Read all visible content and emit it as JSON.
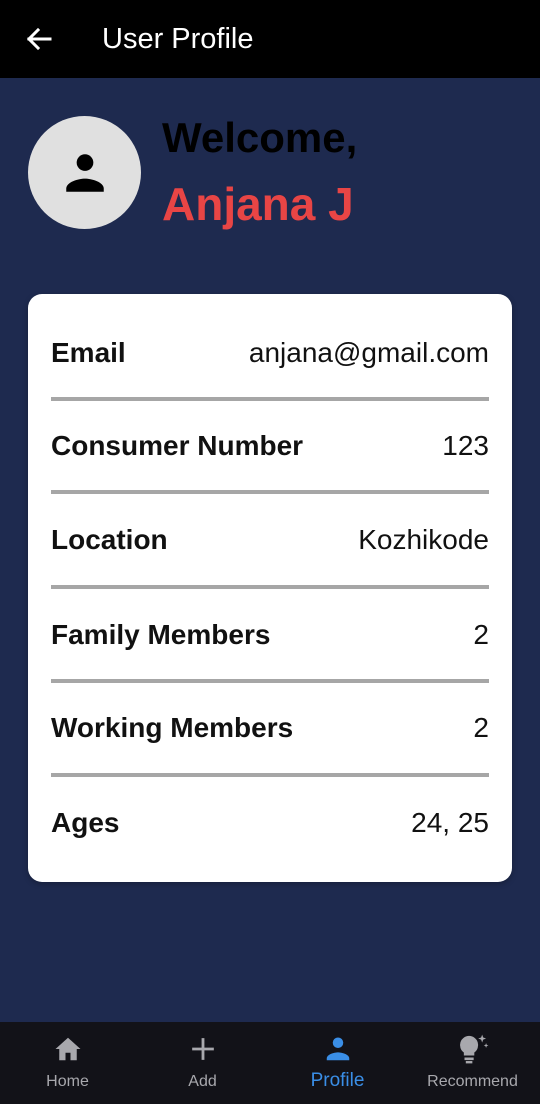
{
  "appbar": {
    "title": "User Profile",
    "back_icon": "arrow-back-icon"
  },
  "header": {
    "avatar_icon": "person-icon",
    "welcome": "Welcome,",
    "name": "Anjana J",
    "name_color": "#e84545"
  },
  "profile": {
    "rows": [
      {
        "label": "Email",
        "value": "anjana@gmail.com"
      },
      {
        "label": "Consumer Number",
        "value": "123"
      },
      {
        "label": "Location",
        "value": "Kozhikode"
      },
      {
        "label": "Family Members",
        "value": "2"
      },
      {
        "label": "Working Members",
        "value": "2"
      },
      {
        "label": "Ages",
        "value": "24, 25"
      }
    ]
  },
  "nav": {
    "items": [
      {
        "label": "Home",
        "icon": "home-icon"
      },
      {
        "label": "Add",
        "icon": "plus-icon"
      },
      {
        "label": "Profile",
        "icon": "person-icon",
        "active": true
      },
      {
        "label": "Recommend",
        "icon": "lightbulb-icon"
      }
    ],
    "active_color": "#3a8ee6",
    "inactive_color": "#a8a8ad"
  },
  "colors": {
    "background": "#1e2a4f",
    "appbar": "#000000",
    "card": "#ffffff",
    "divider": "#a6a6a6"
  }
}
